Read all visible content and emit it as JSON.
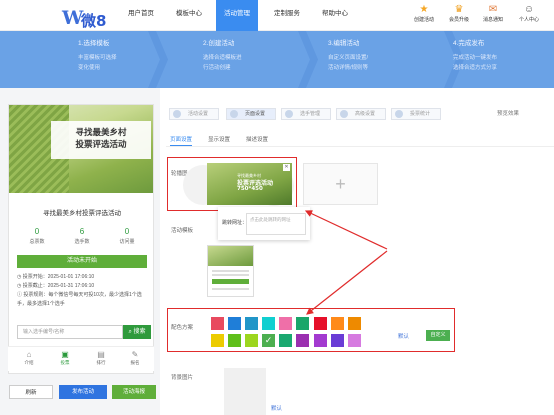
{
  "header": {
    "logo_letter": "W",
    "logo_text": "微8",
    "nav": [
      "用户首页",
      "模板中心",
      "活动管理",
      "定制服务",
      "帮助中心"
    ],
    "active_nav": "活动管理",
    "right_icons": [
      {
        "label": "创建活动",
        "icon": "star-icon"
      },
      {
        "label": "会员升级",
        "icon": "crown-icon"
      },
      {
        "label": "消息通知",
        "icon": "bell-icon"
      },
      {
        "label": "个人中心",
        "icon": "user-icon"
      }
    ]
  },
  "steps": [
    {
      "title": "1.选择模板",
      "desc": "丰富模板可选择\n变化使用"
    },
    {
      "title": "2.创建活动",
      "desc": "选择合适模板进\n行活动创建"
    },
    {
      "title": "3.编辑活动",
      "desc": "自定义页面设置/\n活动详情/规则等"
    },
    {
      "title": "4.完成发布",
      "desc": "完成活动一键发布\n选择合适方式分享"
    }
  ],
  "phone": {
    "hero_line1": "寻找最美乡村",
    "hero_line2": "投票评选活动",
    "title": "寻找最美乡村投票评选活动",
    "stats": [
      {
        "value": "0",
        "label": "总票数"
      },
      {
        "value": "6",
        "label": "选手数"
      },
      {
        "value": "0",
        "label": "访问量"
      }
    ],
    "start_button": "活动未开始",
    "info": [
      {
        "icon": "clock-icon",
        "text": "投票开始：2025-01-01 17:06:10"
      },
      {
        "icon": "clock-icon",
        "text": "投票截止：2025-01-31 17:06:10"
      },
      {
        "icon": "info-icon",
        "text": "投票规则：每个微信号每天可投10次，最少选择1个选手，最多选择1个选手"
      }
    ],
    "search_placeholder": "输入选手编号/名称",
    "search_button": "搜索",
    "tabs": [
      {
        "label": "介绍",
        "icon": "home-icon"
      },
      {
        "label": "投票",
        "icon": "vote-icon"
      },
      {
        "label": "排行",
        "icon": "rank-icon"
      },
      {
        "label": "报名",
        "icon": "signup-icon"
      }
    ]
  },
  "bottom_buttons": [
    "刷新",
    "发布活动",
    "活动海报"
  ],
  "config_tabs": [
    "活动设置",
    "页面设置",
    "选手管理",
    "高级设置",
    "投票统计"
  ],
  "active_config_tab": "页面设置",
  "preview_label": "预览效果",
  "sub_tabs": [
    "页面设置",
    "显示设置",
    "描述设置"
  ],
  "labels": {
    "carousel": "轮播图",
    "activity_image": "活动模板",
    "color_scheme": "配色方案",
    "background": "背景图片",
    "jump_url": "跳转网址：",
    "jump_placeholder": "点击此处跳转的网址",
    "default1": "默认",
    "custom": "自定义",
    "default2": "默认"
  },
  "thumb": {
    "line1": "寻找最美乡村",
    "line2": "投票评选活动",
    "size": "750*450"
  },
  "colors": {
    "banner": "#6aa2e6",
    "primary": "#3a8cf0",
    "green": "#5fae3a",
    "highlight_red": "#e02c2c"
  },
  "swatches_row1": [
    "#e84a5f",
    "#1f7ed8",
    "#2196c8",
    "#10cfd0",
    "#ef6fa8",
    "#19a66a",
    "#e6102a",
    "#ff8a1a",
    "#ee8a00"
  ],
  "swatches_row2": [
    "#eccc00",
    "#5fbf1a",
    "#9cd61e",
    "#4caf50",
    "#1aa870",
    "#9b2fb0",
    "#a33ad0",
    "#6a3cd6",
    "#d67ae0"
  ],
  "selected_swatch_row2": 3
}
